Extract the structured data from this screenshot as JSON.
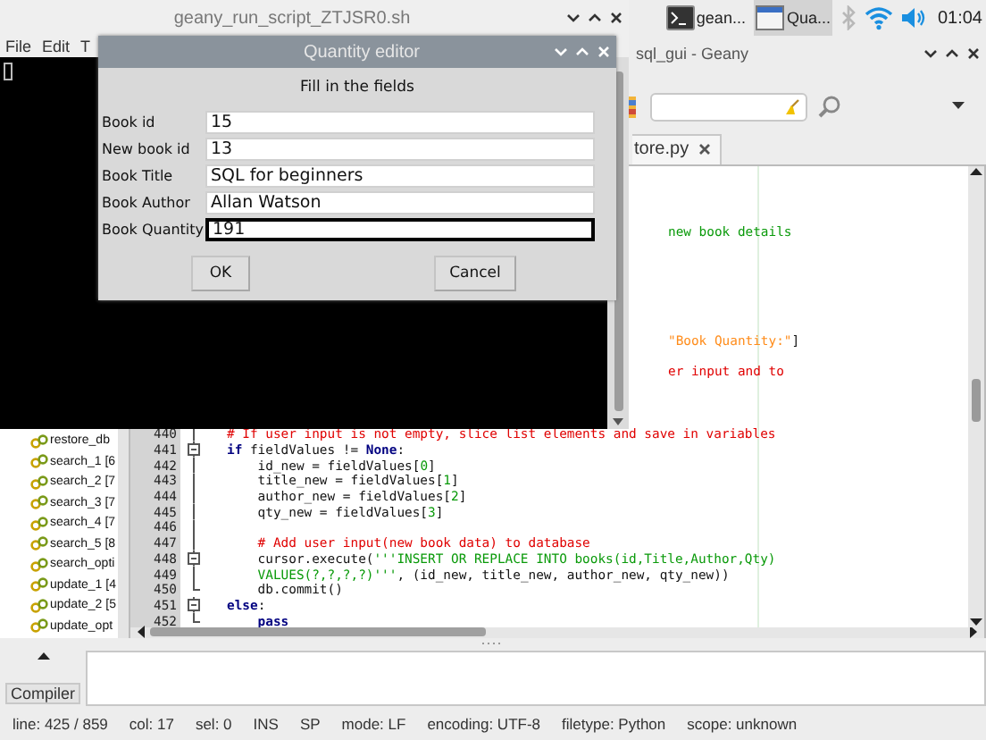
{
  "taskbar": {
    "tasks": [
      {
        "kind": "terminal",
        "label": "gean...",
        "selected": false
      },
      {
        "kind": "window",
        "label": "Qua...",
        "selected": true
      }
    ],
    "clock": "01:04"
  },
  "geany": {
    "title": "sql_gui - Geany",
    "tab": {
      "label": "tore.py"
    },
    "symbols": [
      "restore_db",
      "search_1 [6",
      "search_2 [7",
      "search_3 [7",
      "search_4 [7",
      "search_5 [8",
      "search_opti",
      "update_1 [4",
      "update_2 [5",
      "update_opt"
    ],
    "partly_hidden_lines": [
      {
        "segments": [
          {
            "kind": "docstring",
            "text": "new book details"
          }
        ]
      },
      {
        "segments": [
          {
            "kind": "string",
            "text": "\"Book Quantity:\""
          },
          {
            "kind": "plain",
            "text": "]"
          }
        ]
      },
      {
        "segments": [
          {
            "kind": "comment",
            "text": "er input and to"
          }
        ]
      }
    ],
    "lines": [
      {
        "number": "440",
        "fold_open": false,
        "fold_end": false,
        "segments": [
          {
            "kind": "comment",
            "text": "# If user input is not empty, slice list elements and save in variables"
          }
        ]
      },
      {
        "number": "441",
        "fold_open": true,
        "fold_end": false,
        "segments": [
          {
            "kind": "keyword",
            "text": "if"
          },
          {
            "kind": "plain",
            "text": " fieldValues != "
          },
          {
            "kind": "keyword",
            "text": "None"
          },
          {
            "kind": "plain",
            "text": ":"
          }
        ]
      },
      {
        "number": "442",
        "fold_open": false,
        "fold_end": false,
        "segments": [
          {
            "kind": "plain",
            "text": "    id_new = fieldValues["
          },
          {
            "kind": "number",
            "text": "0"
          },
          {
            "kind": "plain",
            "text": "]"
          }
        ]
      },
      {
        "number": "443",
        "fold_open": false,
        "fold_end": false,
        "segments": [
          {
            "kind": "plain",
            "text": "    title_new = fieldValues["
          },
          {
            "kind": "number",
            "text": "1"
          },
          {
            "kind": "plain",
            "text": "]"
          }
        ]
      },
      {
        "number": "444",
        "fold_open": false,
        "fold_end": false,
        "segments": [
          {
            "kind": "plain",
            "text": "    author_new = fieldValues["
          },
          {
            "kind": "number",
            "text": "2"
          },
          {
            "kind": "plain",
            "text": "]"
          }
        ]
      },
      {
        "number": "445",
        "fold_open": false,
        "fold_end": false,
        "segments": [
          {
            "kind": "plain",
            "text": "    qty_new = fieldValues["
          },
          {
            "kind": "number",
            "text": "3"
          },
          {
            "kind": "plain",
            "text": "]"
          }
        ]
      },
      {
        "number": "446",
        "fold_open": false,
        "fold_end": false
      },
      {
        "number": "447",
        "fold_open": false,
        "fold_end": false,
        "segments": [
          {
            "kind": "comment",
            "text": "    # Add user input(new book data) to database"
          }
        ]
      },
      {
        "number": "448",
        "fold_open": true,
        "fold_end": false,
        "segments": [
          {
            "kind": "plain",
            "text": "    cursor.execute("
          },
          {
            "kind": "docstring",
            "text": "'''INSERT OR REPLACE INTO books(id,Title,Author,Qty)"
          }
        ]
      },
      {
        "number": "449",
        "fold_open": false,
        "fold_end": false,
        "segments": [
          {
            "kind": "docstring",
            "text": "    VALUES(?,?,?,?)'''"
          },
          {
            "kind": "plain",
            "text": ", (id_new, title_new, author_new, qty_new))"
          }
        ]
      },
      {
        "number": "450",
        "fold_open": false,
        "fold_end": true,
        "segments": [
          {
            "kind": "plain",
            "text": "    db.commit()"
          }
        ]
      },
      {
        "number": "451",
        "fold_open": true,
        "fold_end": false,
        "segments": [
          {
            "kind": "keyword",
            "text": "else"
          },
          {
            "kind": "plain",
            "text": ":"
          }
        ]
      },
      {
        "number": "452",
        "fold_open": false,
        "fold_end": true,
        "segments": [
          {
            "kind": "keyword",
            "text": "    pass"
          }
        ]
      }
    ],
    "message_tab": "Compiler",
    "status_bar": [
      "line: 425 / 859",
      "col: 17",
      "sel: 0",
      "INS",
      "SP",
      "mode: LF",
      "encoding: UTF-8",
      "filetype: Python",
      "scope: unknown"
    ]
  },
  "terminal": {
    "title": "geany_run_script_ZTJSR0.sh",
    "menu": [
      "File",
      "Edit",
      "T"
    ]
  },
  "dialog": {
    "title": "Quantity editor",
    "heading": "Fill in the fields",
    "fields": [
      {
        "label": "Book id",
        "value": "15",
        "focused": false
      },
      {
        "label": "New book id",
        "value": "13",
        "focused": false
      },
      {
        "label": "Book Title",
        "value": "SQL for beginners",
        "focused": false
      },
      {
        "label": "Book Author",
        "value": "Allan Watson",
        "focused": false
      },
      {
        "label": "Book Quantity",
        "value": "191",
        "focused": true
      }
    ],
    "buttons": [
      "OK",
      "Cancel"
    ]
  }
}
